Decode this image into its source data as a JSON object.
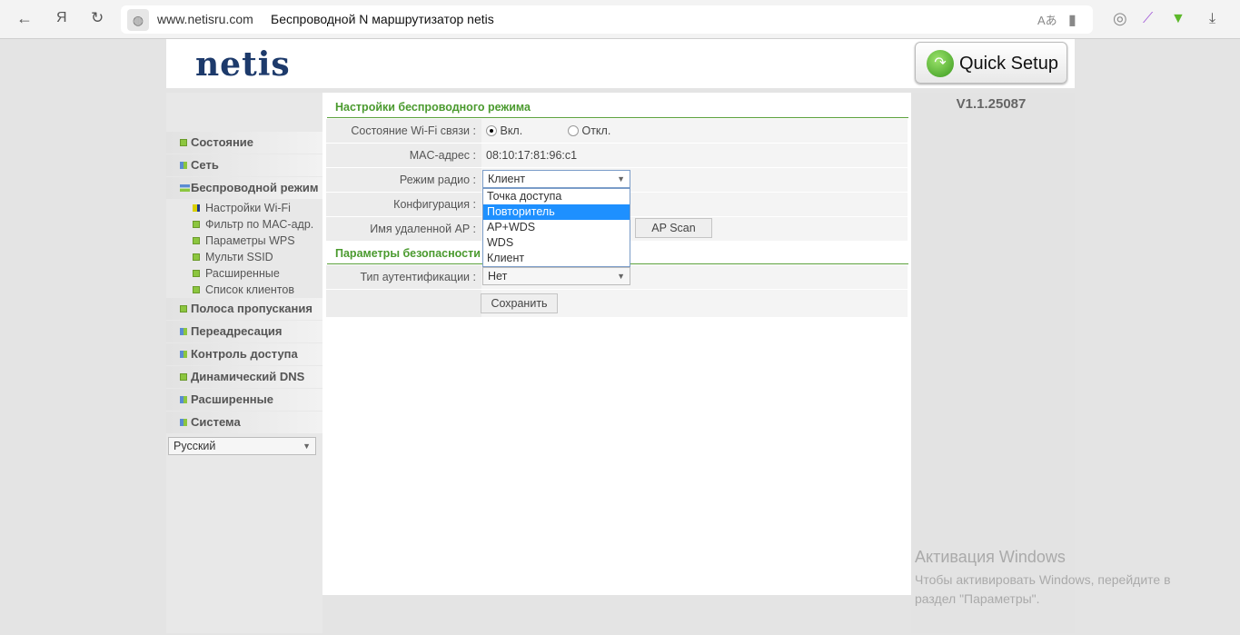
{
  "browser": {
    "url": "www.netisru.com",
    "title": "Беспроводной N маршрутизатор netis",
    "yandex": "Я"
  },
  "header": {
    "logo": "netis",
    "quick_setup": "Quick Setup",
    "version": "V1.1.25087"
  },
  "sidebar": {
    "items": [
      {
        "label": "Состояние",
        "icon": "plus"
      },
      {
        "label": "Сеть",
        "icon": "grid"
      },
      {
        "label": "Беспроводной режим",
        "icon": "bars"
      }
    ],
    "subitems": [
      "Настройки Wi-Fi",
      "Фильтр по MAC-адр.",
      "Параметры WPS",
      "Мульти SSID",
      "Расширенные",
      "Список клиентов"
    ],
    "items2": [
      "Полоса пропускания",
      "Переадресация",
      "Контроль доступа",
      "Динамический DNS",
      "Расширенные",
      "Система"
    ],
    "language": "Русский"
  },
  "main": {
    "section1": "Настройки беспроводного режима",
    "wifi_label": "Состояние Wi-Fi связи :",
    "wifi_on": "Вкл.",
    "wifi_off": "Откл.",
    "mac_label": "MAC-адрес :",
    "mac_value": "08:10:17:81:96:c1",
    "mode_label": "Режим радио :",
    "mode_value": "Клиент",
    "mode_options": [
      "Точка доступа",
      "Повторитель",
      "AP+WDS",
      "WDS",
      "Клиент"
    ],
    "config_label": "Конфигурация :",
    "remote_label": "Имя удаленной AP :",
    "ap_scan": "AP Scan",
    "section2": "Параметры безопасности",
    "auth_label": "Тип аутентификации :",
    "auth_value": "Нет",
    "save": "Сохранить"
  },
  "watermark": {
    "title": "Активация Windows",
    "text": "Чтобы активировать Windows, перейдите в раздел \"Параметры\"."
  }
}
